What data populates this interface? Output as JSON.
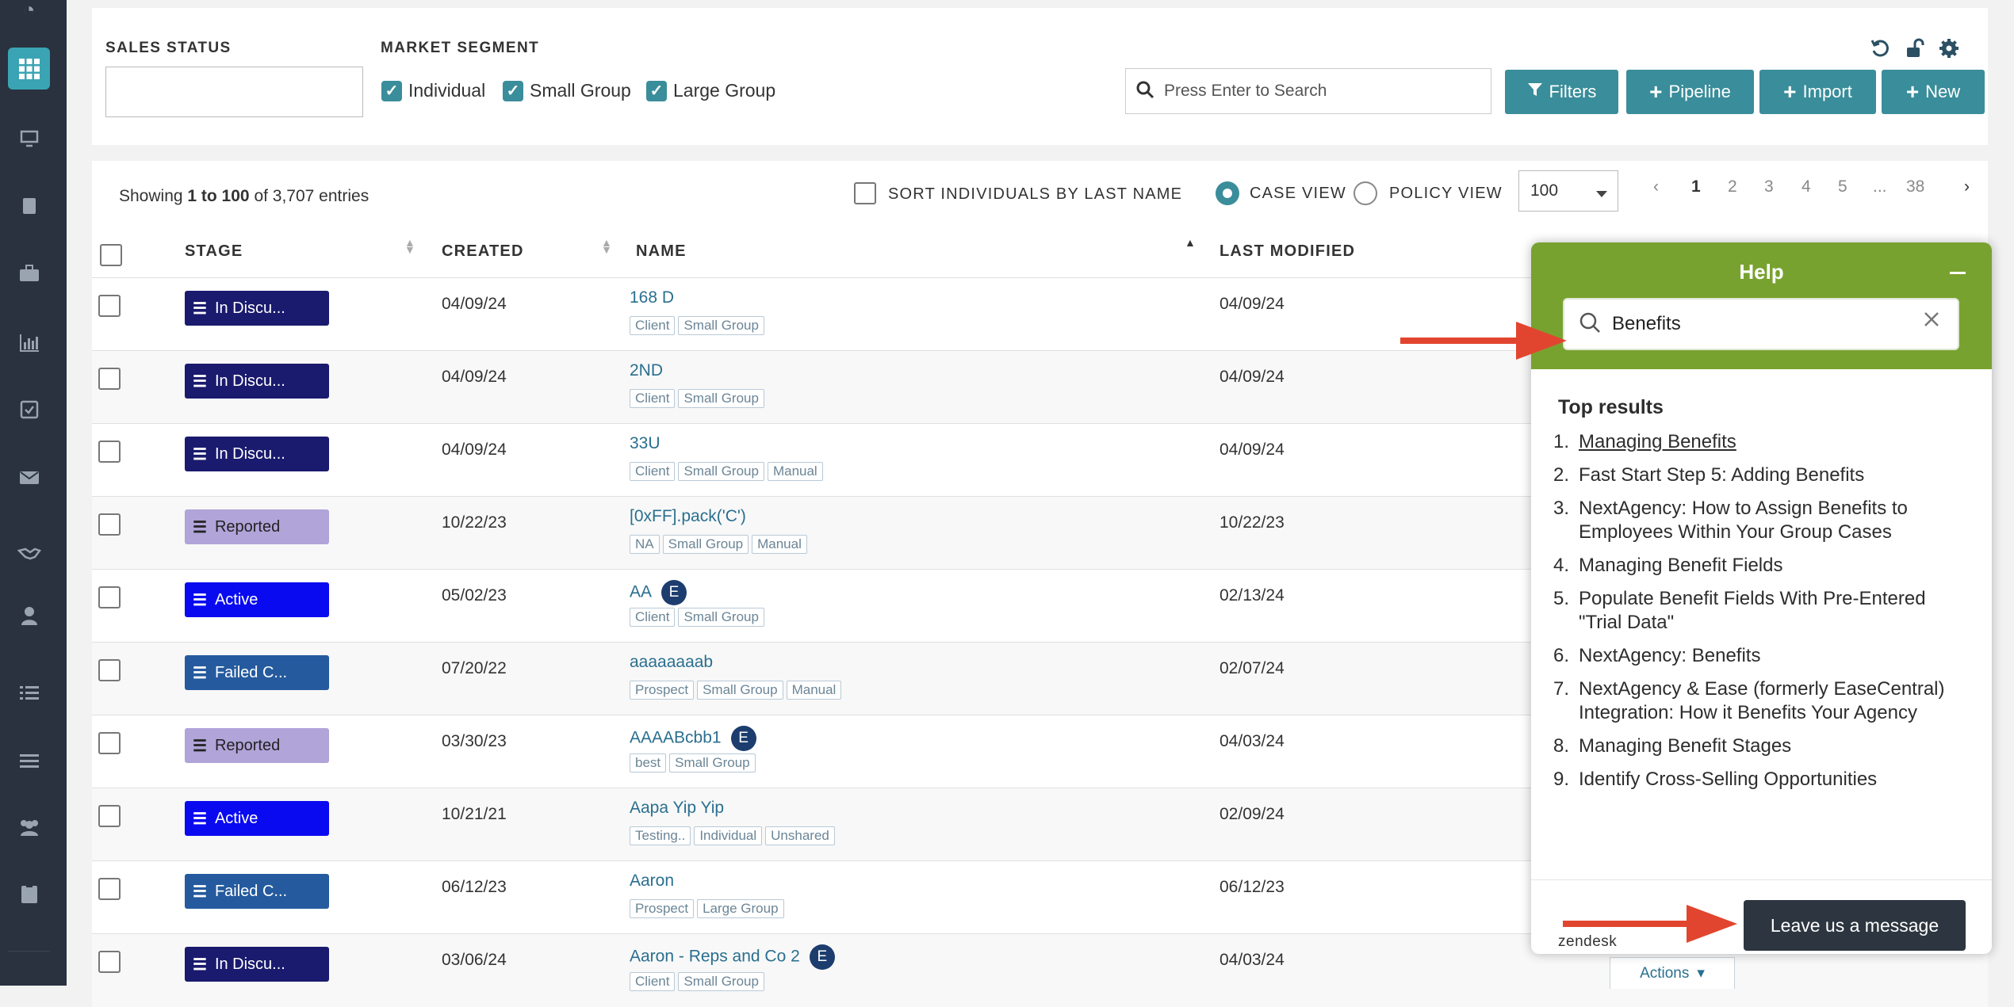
{
  "sidebar": {
    "icons": [
      "pie-chart-icon",
      "grid-icon",
      "monitor-icon",
      "book-icon",
      "briefcase-icon",
      "bar-chart-icon",
      "calendar-check-icon",
      "envelope-icon",
      "handshake-icon",
      "user-icon",
      "list-icon",
      "menu-icon",
      "users-icon",
      "clipboard-icon"
    ]
  },
  "filters": {
    "sales_status_label": "SALES STATUS",
    "market_segment_label": "MARKET SEGMENT",
    "segments": [
      "Individual",
      "Small Group",
      "Large Group"
    ],
    "search_placeholder": "Press Enter to Search",
    "buttons": {
      "filters": "Filters",
      "pipeline": "Pipeline",
      "import": "Import",
      "new": "New"
    }
  },
  "table": {
    "showing_prefix": "Showing ",
    "showing_range": "1 to 100",
    "showing_suffix": " of 3,707 entries",
    "sort_label": "SORT INDIVIDUALS BY LAST NAME",
    "case_view": "CASE VIEW",
    "policy_view": "POLICY VIEW",
    "page_size": "100",
    "pagination": [
      "1",
      "2",
      "3",
      "4",
      "5",
      "...",
      "38"
    ],
    "columns": {
      "stage": "STAGE",
      "created": "CREATED",
      "name": "NAME",
      "last_modified": "LAST MODIFIED"
    },
    "rows": [
      {
        "stage": "In Discu...",
        "stage_color": "#1a1a6e",
        "created": "04/09/24",
        "name": "168 D",
        "tags": [
          "Client",
          "Small Group"
        ],
        "badge": "",
        "modified": "04/09/24"
      },
      {
        "stage": "In Discu...",
        "stage_color": "#1a1a6e",
        "created": "04/09/24",
        "name": "2ND",
        "tags": [
          "Client",
          "Small Group"
        ],
        "badge": "",
        "modified": "04/09/24"
      },
      {
        "stage": "In Discu...",
        "stage_color": "#1a1a6e",
        "created": "04/09/24",
        "name": "33U",
        "tags": [
          "Client",
          "Small Group",
          "Manual"
        ],
        "badge": "",
        "modified": "04/09/24"
      },
      {
        "stage": "Reported",
        "stage_color": "#b0a4d9",
        "created": "10/22/23",
        "name": "[0xFF].pack('C')",
        "tags": [
          "NA",
          "Small Group",
          "Manual"
        ],
        "badge": "",
        "modified": "10/22/23"
      },
      {
        "stage": "Active",
        "stage_color": "#0a0af0",
        "created": "05/02/23",
        "name": "AA",
        "tags": [
          "Client",
          "Small Group"
        ],
        "badge": "E",
        "modified": "02/13/24"
      },
      {
        "stage": "Failed C...",
        "stage_color": "#255a9e",
        "created": "07/20/22",
        "name": "aaaaaaaab",
        "tags": [
          "Prospect",
          "Small Group",
          "Manual"
        ],
        "badge": "",
        "modified": "02/07/24"
      },
      {
        "stage": "Reported",
        "stage_color": "#b0a4d9",
        "created": "03/30/23",
        "name": "AAAABcbb1",
        "tags": [
          "best",
          "Small Group"
        ],
        "badge": "E",
        "modified": "04/03/24"
      },
      {
        "stage": "Active",
        "stage_color": "#0a0af0",
        "created": "10/21/21",
        "name": "Aapa Yip Yip",
        "tags": [
          "Testing..",
          "Individual",
          "Unshared"
        ],
        "badge": "",
        "modified": "02/09/24"
      },
      {
        "stage": "Failed C...",
        "stage_color": "#255a9e",
        "created": "06/12/23",
        "name": "Aaron",
        "tags": [
          "Prospect",
          "Large Group"
        ],
        "badge": "",
        "modified": "06/12/23"
      },
      {
        "stage": "In Discu...",
        "stage_color": "#1a1a6e",
        "created": "03/06/24",
        "name": "Aaron - Reps and Co 2",
        "tags": [
          "Client",
          "Small Group"
        ],
        "badge": "E",
        "modified": "04/03/24"
      }
    ],
    "actions_label": "Actions"
  },
  "help": {
    "title": "Help",
    "search_value": "Benefits",
    "top_results_label": "Top results",
    "results": [
      "Managing Benefits",
      "Fast Start Step 5: Adding Benefits",
      "NextAgency: How to Assign Benefits to Employees Within Your Group Cases",
      "Managing Benefit Fields",
      "Populate Benefit Fields With Pre-Entered \"Trial Data\"",
      "NextAgency: Benefits",
      "NextAgency & Ease (formerly EaseCentral) Integration: How it Benefits Your Agency",
      "Managing Benefit Stages",
      "Identify Cross-Selling Opportunities"
    ],
    "brand": "zendesk",
    "leave_message": "Leave us a message"
  },
  "colors": {
    "accent": "#3a8d9a",
    "help_header": "#78a22f",
    "arrow": "#e2452f"
  }
}
